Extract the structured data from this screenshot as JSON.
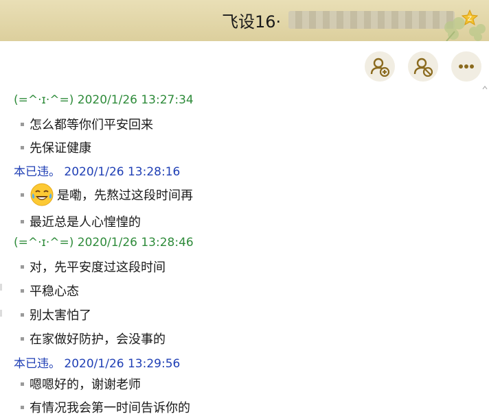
{
  "window": {
    "title": "飞设16·"
  },
  "toolbar": {
    "buttons": [
      {
        "name": "add-contact",
        "icon": "person-add-icon"
      },
      {
        "name": "remove-contact",
        "icon": "person-block-icon"
      },
      {
        "name": "more",
        "icon": "more-dots-icon"
      }
    ]
  },
  "messages": [
    {
      "type": "header",
      "sender": "(=^·ɪ·^=)",
      "time": "2020/1/26 13:27:34",
      "color": "#2e8b3a"
    },
    {
      "type": "text",
      "text": "怎么都等你们平安回来"
    },
    {
      "type": "text",
      "text": "先保证健康"
    },
    {
      "type": "header",
      "sender": "本已违。",
      "time": "2020/1/26 13:28:16",
      "color": "#1f3fb5"
    },
    {
      "type": "text",
      "text": "是嘞，先熬过这段时间再",
      "emoji": "laughing-tears-emoji"
    },
    {
      "type": "text",
      "text": "最近总是人心惶惶的"
    },
    {
      "type": "header",
      "sender": "(=^·ɪ·^=)",
      "time": "2020/1/26 13:28:46",
      "color": "#2e8b3a"
    },
    {
      "type": "text",
      "text": "对，先平安度过这段时间"
    },
    {
      "type": "text",
      "text": "平稳心态"
    },
    {
      "type": "text",
      "text": "别太害怕了"
    },
    {
      "type": "text",
      "text": "在家做好防护，会没事的"
    },
    {
      "type": "header",
      "sender": "本已违。",
      "time": "2020/1/26 13:29:56",
      "color": "#1f3fb5"
    },
    {
      "type": "text",
      "text": "嗯嗯好的，谢谢老师"
    },
    {
      "type": "text",
      "text": "有情况我会第一时间告诉你的"
    }
  ]
}
